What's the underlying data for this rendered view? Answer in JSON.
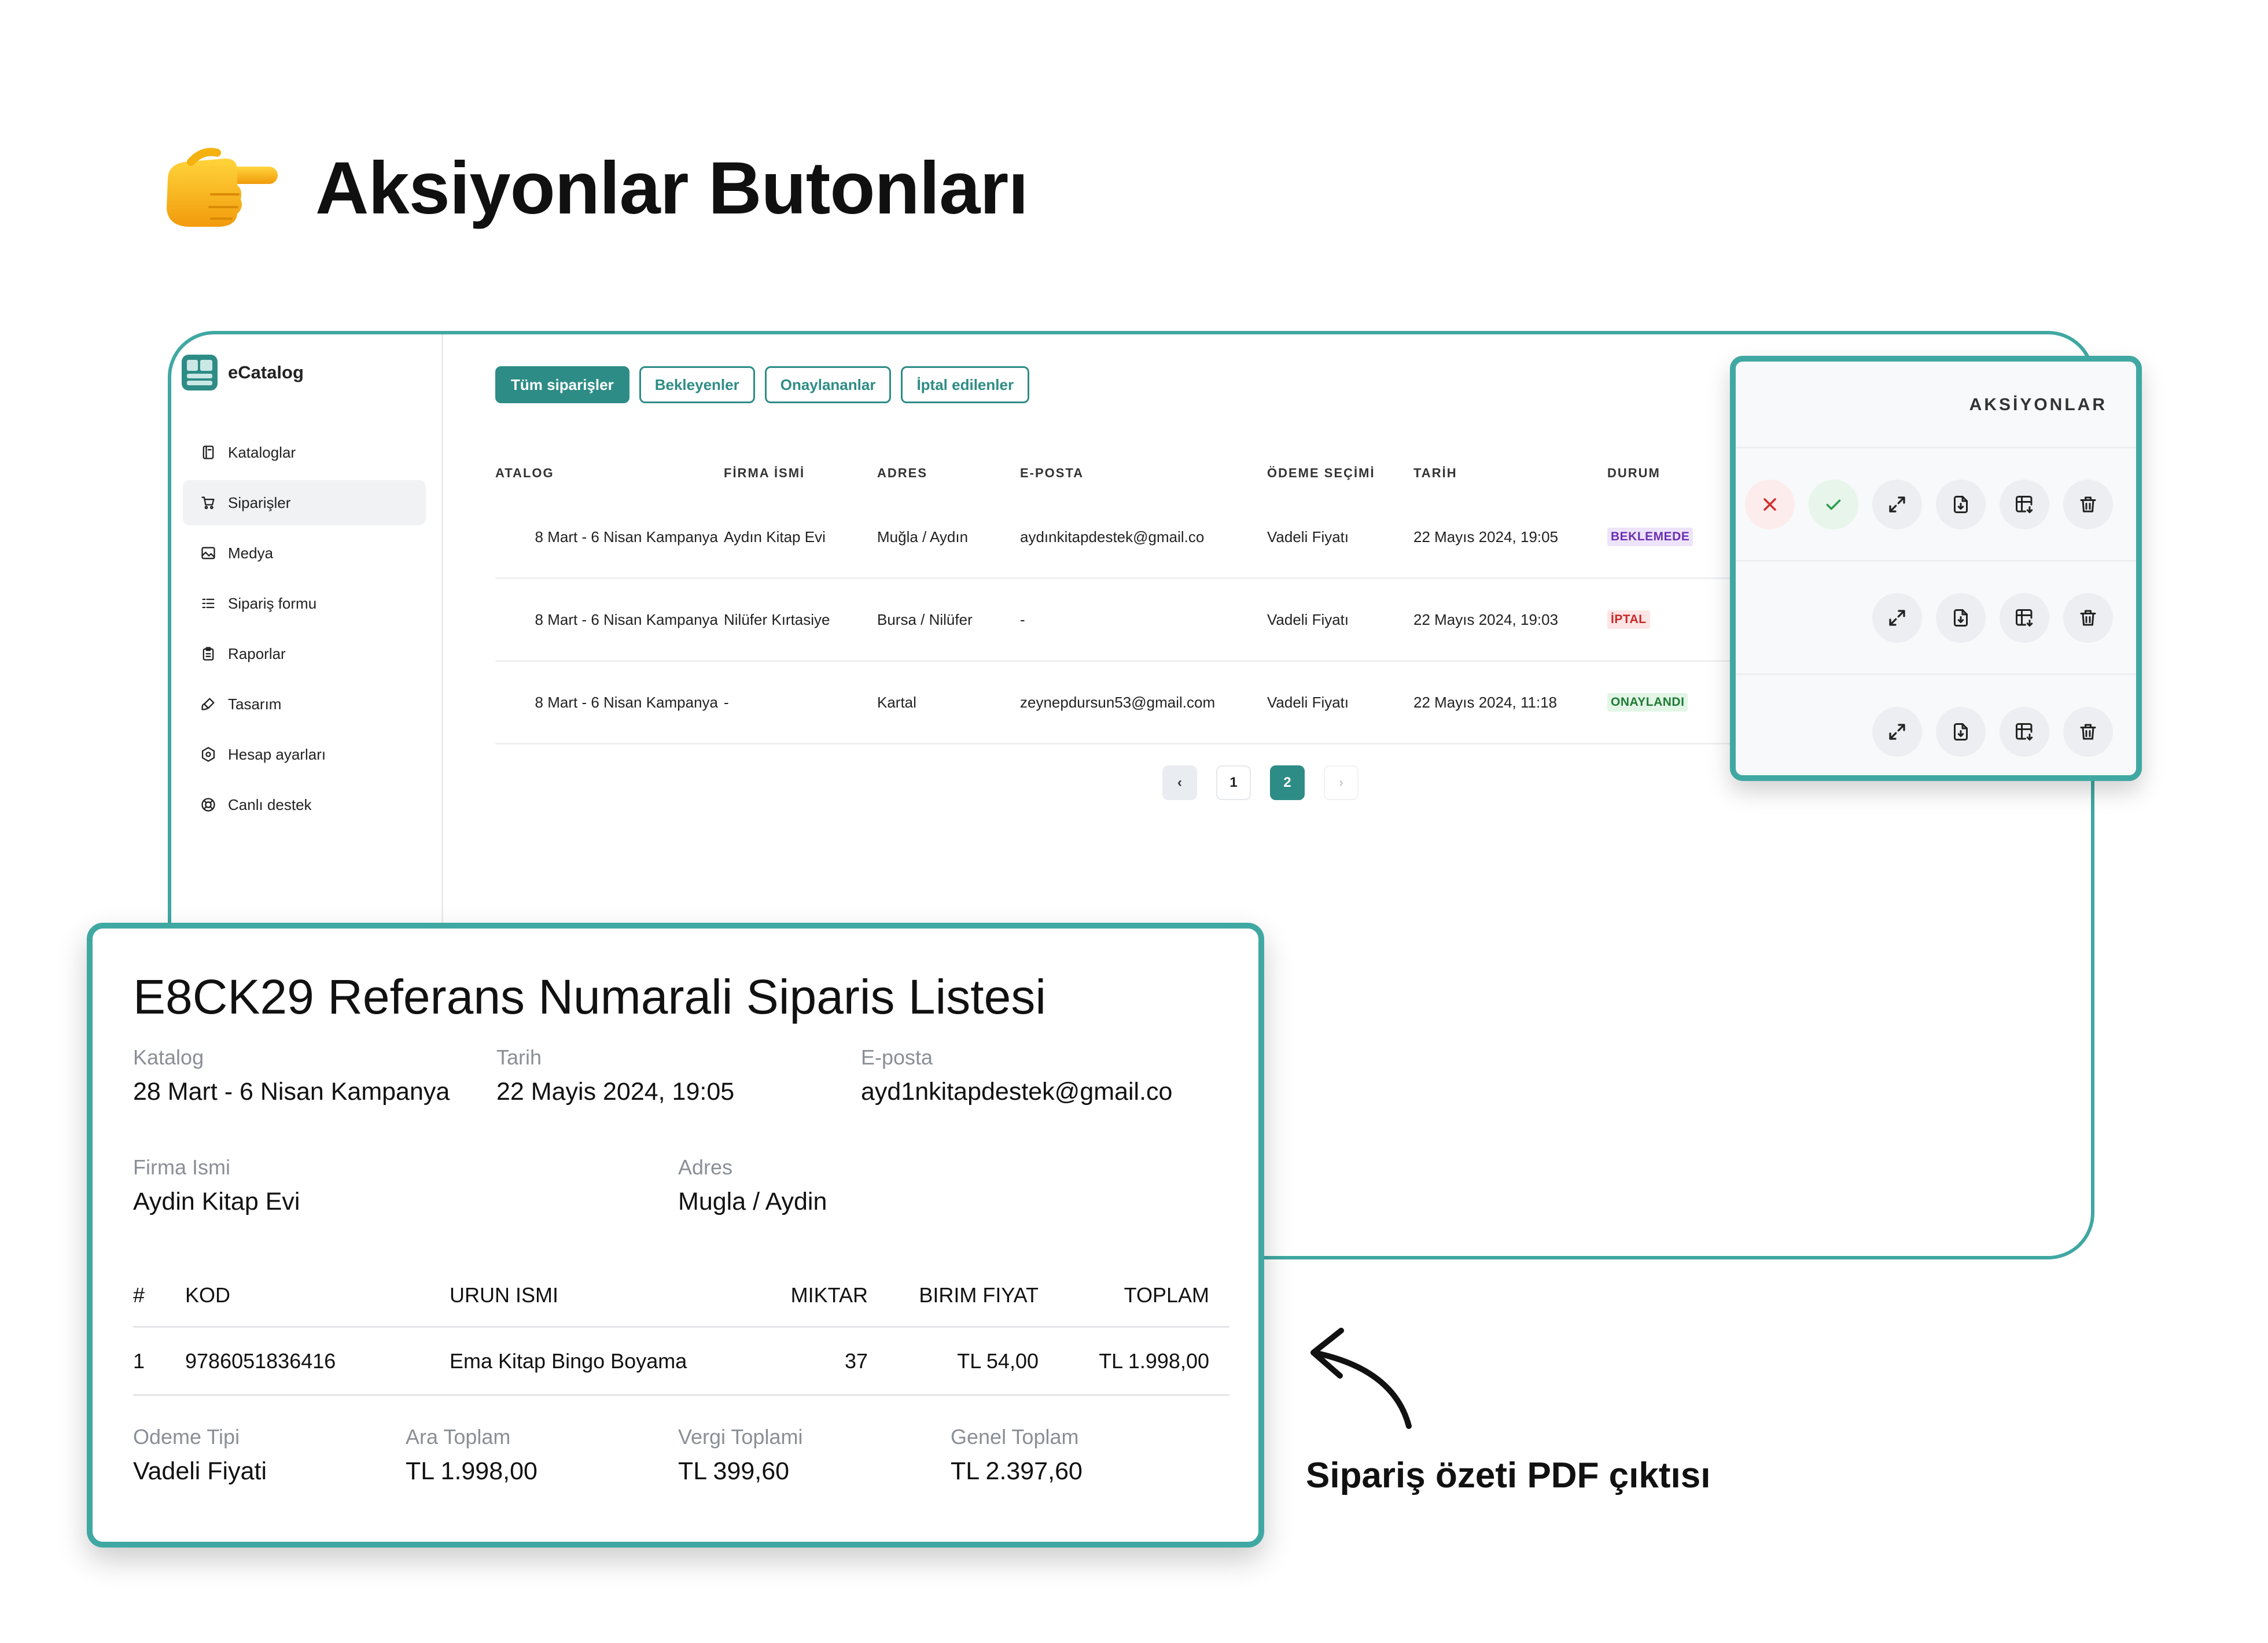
{
  "headline": "Aksiyonlar Butonları",
  "app": {
    "brand": "eCatalog",
    "nav": [
      {
        "label": "Kataloglar",
        "icon": "book-icon"
      },
      {
        "label": "Siparişler",
        "icon": "cart-icon",
        "active": true
      },
      {
        "label": "Medya",
        "icon": "image-icon"
      },
      {
        "label": "Sipariş formu",
        "icon": "list-icon"
      },
      {
        "label": "Raporlar",
        "icon": "clipboard-icon"
      },
      {
        "label": "Tasarım",
        "icon": "brush-icon"
      },
      {
        "label": "Hesap ayarları",
        "icon": "settings-icon"
      },
      {
        "label": "Canlı destek",
        "icon": "support-icon"
      }
    ],
    "tabs": [
      {
        "label": "Tüm siparişler",
        "active": true
      },
      {
        "label": "Bekleyenler"
      },
      {
        "label": "Onaylananlar"
      },
      {
        "label": "İptal edilenler"
      }
    ],
    "columns": [
      "ATALOG",
      "FİRMA İSMİ",
      "ADRES",
      "E-POSTA",
      "ÖDEME SEÇİMİ",
      "TARİH",
      "DURUM"
    ],
    "rows": [
      {
        "katalog": "8 Mart - 6 Nisan Kampanya",
        "firma": "Aydın Kitap Evi",
        "adres": "Muğla / Aydın",
        "eposta": "aydınkitapdestek@gmail.co",
        "odeme": "Vadeli Fiyatı",
        "tarih": "22 Mayıs 2024, 19:05",
        "durum": "BEKLEMEDE"
      },
      {
        "katalog": "8 Mart - 6 Nisan Kampanya",
        "firma": "Nilüfer Kırtasiye",
        "adres": "Bursa / Nilüfer",
        "eposta": "-",
        "odeme": "Vadeli Fiyatı",
        "tarih": "22 Mayıs 2024, 19:03",
        "durum": "İPTAL"
      },
      {
        "katalog": "8 Mart - 6 Nisan Kampanya",
        "firma": "-",
        "adres": "Kartal",
        "eposta": "zeynepdursun53@gmail.com",
        "odeme": "Vadeli Fiyatı",
        "tarih": "22 Mayıs 2024, 11:18",
        "durum": "ONAYLANDI"
      }
    ],
    "status_colors": {
      "BEKLEMEDE": {
        "bg": "#ede4fb",
        "fg": "#6b2fb3"
      },
      "İPTAL": {
        "bg": "#fde5e5",
        "fg": "#c62828"
      },
      "ONAYLANDI": {
        "bg": "#e2f5e6",
        "fg": "#1e7b34"
      }
    },
    "pagination": {
      "prev": "‹",
      "pages": [
        "1",
        "2"
      ],
      "current": "2",
      "next": "›"
    }
  },
  "actions": {
    "title": "AKSİYONLAR",
    "rows": [
      [
        "reject",
        "approve",
        "expand",
        "pdf",
        "excel",
        "delete"
      ],
      [
        "expand",
        "pdf",
        "excel",
        "delete"
      ],
      [
        "expand",
        "pdf",
        "excel",
        "delete"
      ]
    ]
  },
  "pdf": {
    "title": "E8CK29 Referans Numarali Siparis Listesi",
    "katalog_label": "Katalog",
    "katalog_value": "28 Mart - 6 Nisan Kampanya",
    "tarih_label": "Tarih",
    "tarih_value": "22 Mayis 2024, 19:05",
    "eposta_label": "E-posta",
    "eposta_value": "ayd1nkitapdestek@gmail.co",
    "firma_label": "Firma Ismi",
    "firma_value": "Aydin Kitap Evi",
    "adres_label": "Adres",
    "adres_value": "Mugla / Aydin",
    "columns": [
      "#",
      "KOD",
      "URUN ISMI",
      "MIKTAR",
      "BIRIM FIYAT",
      "TOPLAM"
    ],
    "items": [
      {
        "no": "1",
        "kod": "9786051836416",
        "urun": "Ema Kitap Bingo Boyama",
        "miktar": "37",
        "birim": "TL 54,00",
        "toplam": "TL 1.998,00"
      }
    ],
    "odeme_label": "Odeme Tipi",
    "odeme_value": "Vadeli Fiyati",
    "ara_label": "Ara Toplam",
    "ara_value": "TL 1.998,00",
    "vergi_label": "Vergi Toplami",
    "vergi_value": "TL 399,60",
    "genel_label": "Genel Toplam",
    "genel_value": "TL 2.397,60"
  },
  "caption": "Sipariş özeti PDF çıktısı",
  "colors": {
    "accent": "#2e8c86",
    "border": "#40a8a2"
  }
}
